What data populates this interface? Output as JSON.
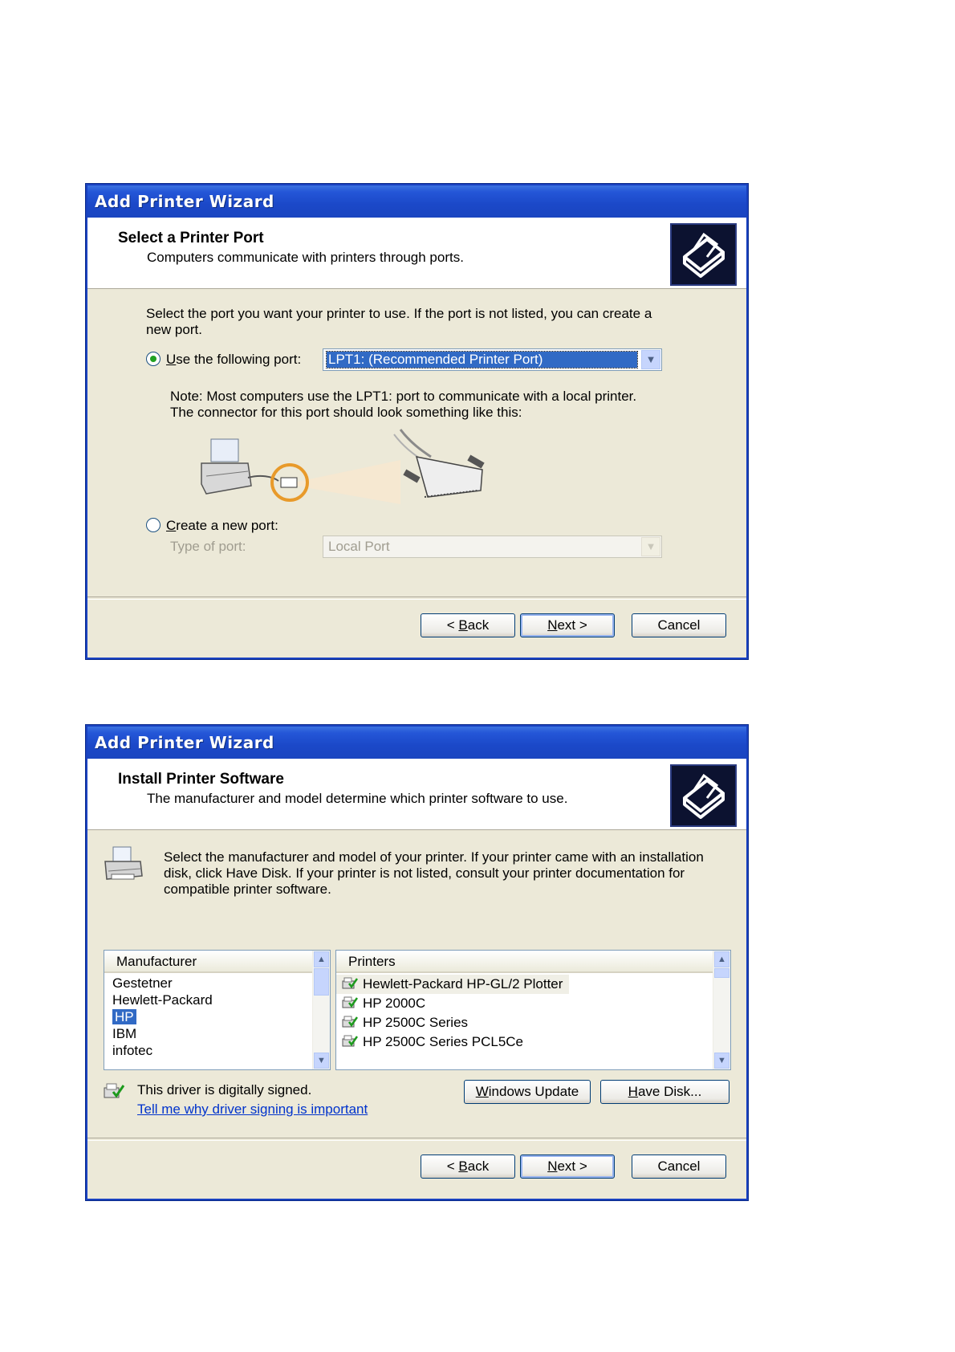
{
  "dialog1": {
    "title": "Add Printer Wizard",
    "header_title": "Select a Printer Port",
    "header_subtitle": "Computers communicate with printers through ports.",
    "instruction_line1": "Select the port you want your printer to use.  If the port is not listed, you can create a",
    "instruction_line2": "new port.",
    "use_port_label": "Use the following port:",
    "use_port_selected": true,
    "port_value": "LPT1: (Recommended Printer Port)",
    "note_line1": "Note: Most computers use the LPT1: port to communicate with a local printer.",
    "note_line2": "The connector for this port should look something like this:",
    "create_port_label": "Create a new port:",
    "create_port_selected": false,
    "type_of_port_label": "Type of port:",
    "type_of_port_value": "Local Port",
    "buttons": {
      "back": "< Back",
      "next": "Next >",
      "cancel": "Cancel"
    }
  },
  "dialog2": {
    "title": "Add Printer Wizard",
    "header_title": "Install Printer Software",
    "header_subtitle": "The manufacturer and model determine which printer software to use.",
    "instruction_line1": "Select the manufacturer and model of your printer. If your printer came with an installation",
    "instruction_line2": "disk, click Have Disk. If your printer is not listed, consult your printer documentation for",
    "instruction_line3": "compatible printer software.",
    "manufacturer_header": "Manufacturer",
    "manufacturers": [
      "Gestetner",
      "Hewlett-Packard",
      "HP",
      "IBM",
      "infotec"
    ],
    "selected_manufacturer": "HP",
    "printers_header": "Printers",
    "printers": [
      "Hewlett-Packard HP-GL/2 Plotter",
      "HP 2000C",
      "HP 2500C Series",
      "HP 2500C Series PCL5Ce"
    ],
    "signed_text": "This driver is digitally signed.",
    "signing_link": "Tell me why driver signing is important",
    "windows_update_button": "Windows Update",
    "have_disk_button": "Have Disk...",
    "buttons": {
      "back": "< Back",
      "next": "Next >",
      "cancel": "Cancel"
    }
  },
  "colors": {
    "title_blue": "#1b48c8",
    "dialog_face": "#ece9d8",
    "selection": "#316ac5",
    "link": "#0033cc"
  }
}
